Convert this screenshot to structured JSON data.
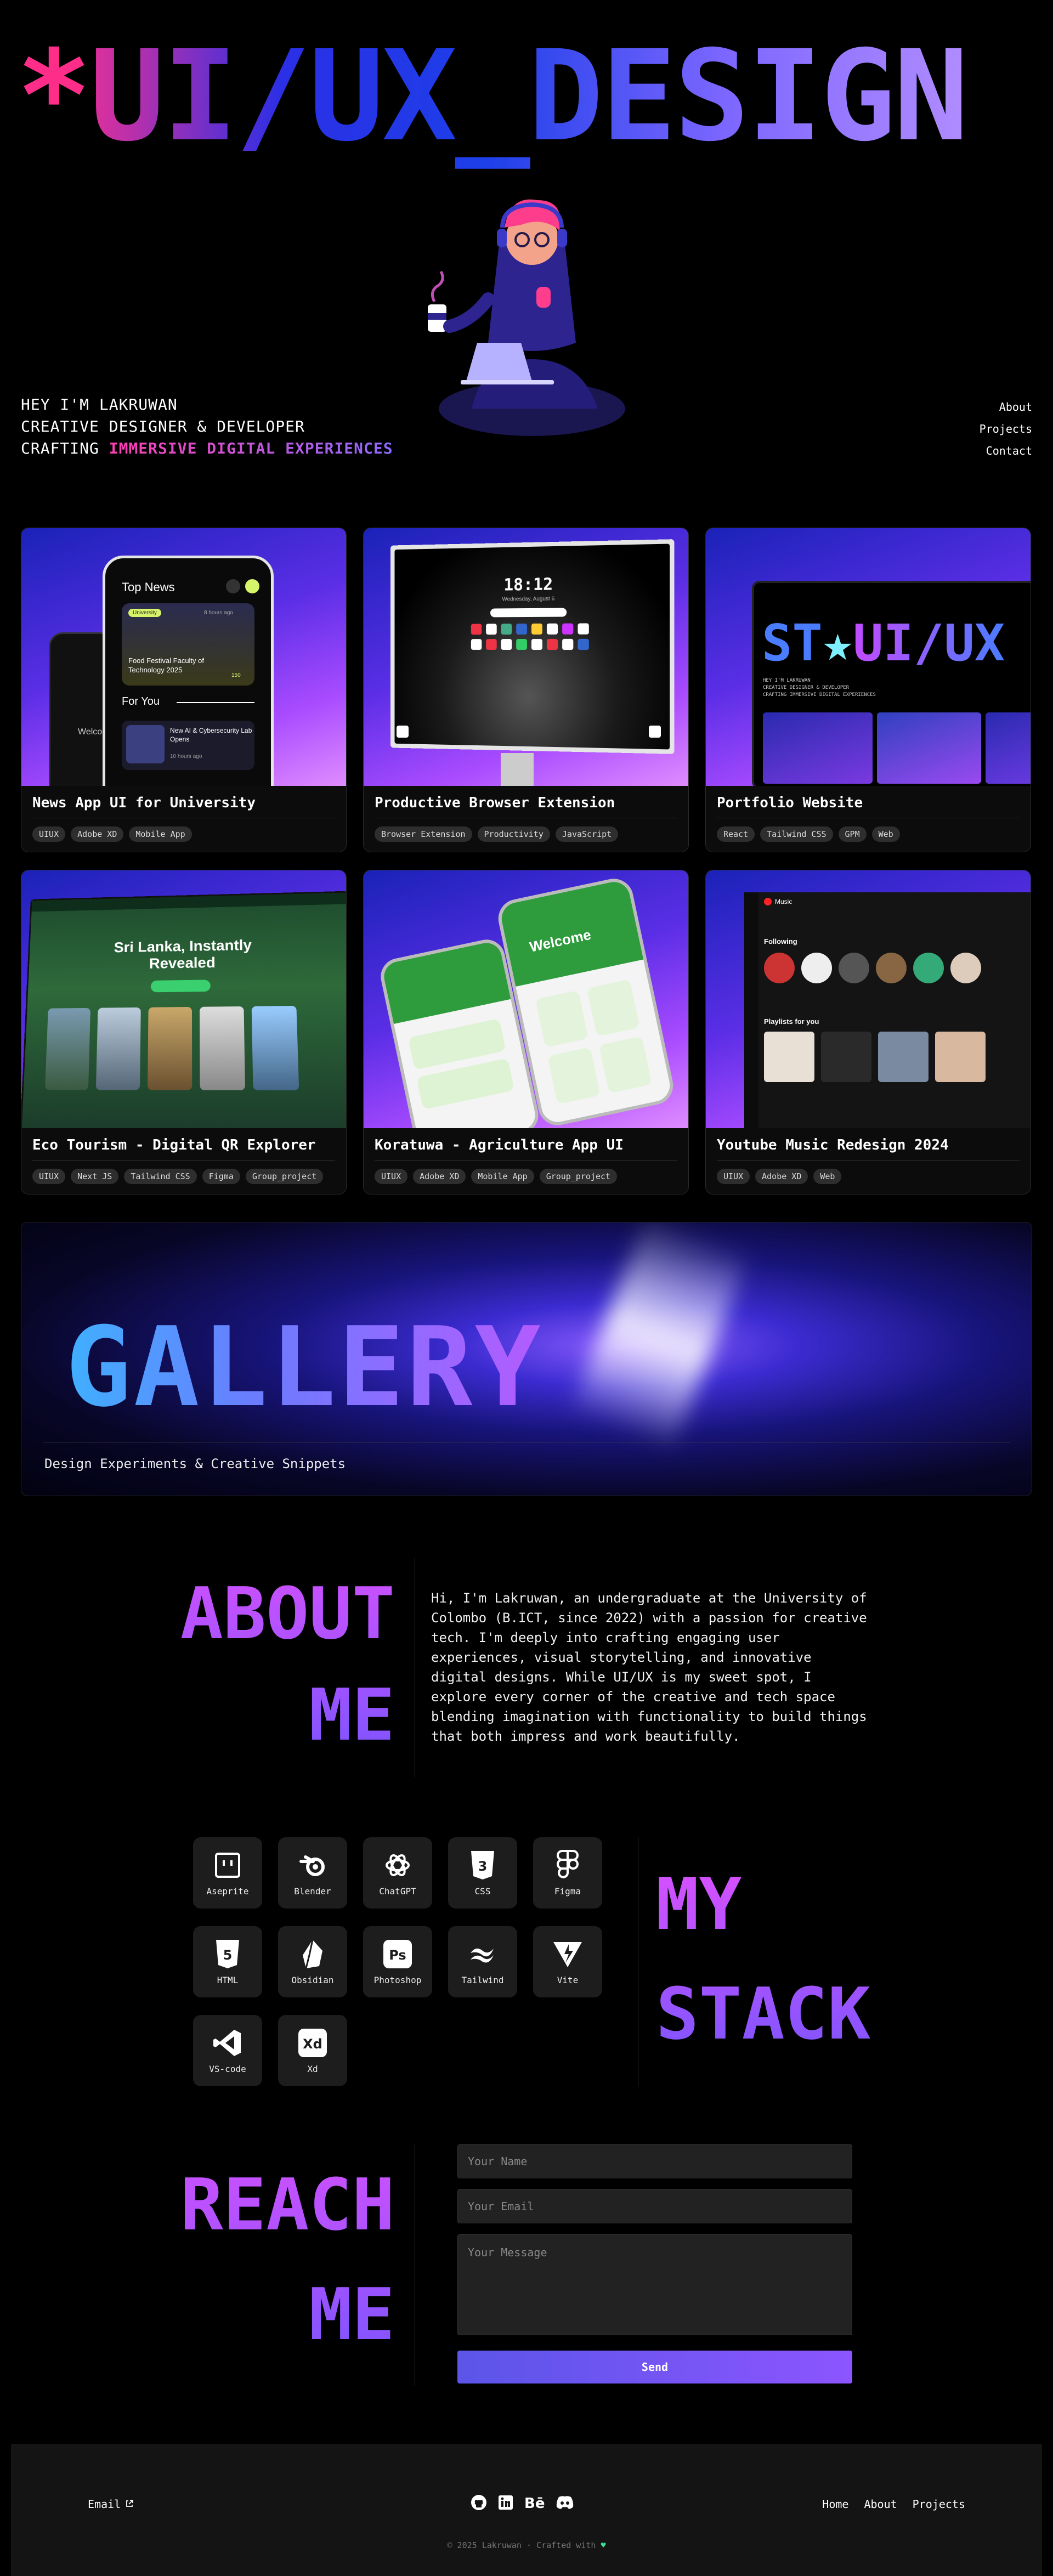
{
  "hero": {
    "asterisk": "*",
    "title": "UI/UX_DESIGN",
    "intro_line1": "HEY I'M LAKRUWAN",
    "intro_line2": "CREATIVE DESIGNER & DEVELOPER",
    "intro_line3_prefix": "CRAFTING ",
    "intro_line3_highlight": "IMMERSIVE DIGITAL EXPERIENCES",
    "nav": [
      "About",
      "Projects",
      "Contact"
    ]
  },
  "projects": [
    {
      "title": "News App UI for University",
      "tags": [
        "UIUX",
        "Adobe XD",
        "Mobile App"
      ],
      "thumb": {
        "heading": "Top News",
        "badge": "University",
        "time1": "8 hours ago",
        "headline1": "Food Festival Faculty of Technology 2025",
        "count": "150",
        "section": "For You",
        "headline2": "New AI & Cybersecurity Lab Opens",
        "time2": "10 hours ago",
        "back_text": "Welco"
      }
    },
    {
      "title": "Productive Browser Extension",
      "tags": [
        "Browser Extension",
        "Productivity",
        "JavaScript"
      ],
      "thumb": {
        "clock": "18:12",
        "date": "Wednesday, August 6"
      }
    },
    {
      "title": "Portfolio Website",
      "tags": [
        "React",
        "Tailwind CSS",
        "GPM",
        "Web"
      ],
      "thumb": {
        "title_left": "ST",
        "title_right": "UI/UX",
        "lines": [
          "HEY I'M LAKRUWAN",
          "CREATIVE DESIGNER & DEVELOPER",
          "CRAFTING IMMERSIVE DIGITAL EXPERIENCES"
        ]
      }
    },
    {
      "title": "Eco Tourism - Digital QR Explorer",
      "tags": [
        "UIUX",
        "Next JS",
        "Tailwind CSS",
        "Figma",
        "Group_project"
      ],
      "thumb": {
        "headline": "Sri Lanka, Instantly Revealed"
      }
    },
    {
      "title": "Koratuwa - Agriculture App UI",
      "tags": [
        "UIUX",
        "Adobe XD",
        "Mobile App",
        "Group_project"
      ],
      "thumb": {
        "welcome": "Welcome"
      }
    },
    {
      "title": "Youtube Music Redesign 2024",
      "tags": [
        "UIUX",
        "Adobe XD",
        "Web"
      ],
      "thumb": {
        "brand": "Music",
        "section1": "Following",
        "section2": "Playlists for you"
      }
    }
  ],
  "gallery": {
    "title": "GALLERY",
    "subtitle": "Design Experiments & Creative Snippets"
  },
  "about": {
    "heading_line1": "ABOUT",
    "heading_line2": "ME",
    "text": "Hi, I'm Lakruwan, an undergraduate at the University of Colombo (B.ICT, since 2022) with a passion for creative tech. I'm deeply into crafting engaging user experiences, visual storytelling, and innovative digital designs. While UI/UX is my sweet spot, I explore every corner of the creative and tech space blending imagination with functionality to build things that both impress and work beautifully."
  },
  "stack": {
    "heading_line1": "MY",
    "heading_line2": "STACK",
    "tools": [
      {
        "label": "Aseprite",
        "icon": "aseprite-icon"
      },
      {
        "label": "Blender",
        "icon": "blender-icon"
      },
      {
        "label": "ChatGPT",
        "icon": "chatgpt-icon"
      },
      {
        "label": "CSS",
        "icon": "css-icon"
      },
      {
        "label": "Figma",
        "icon": "figma-icon"
      },
      {
        "label": "HTML",
        "icon": "html-icon"
      },
      {
        "label": "Obsidian",
        "icon": "obsidian-icon"
      },
      {
        "label": "Photoshop",
        "icon": "photoshop-icon"
      },
      {
        "label": "Tailwind",
        "icon": "tailwind-icon"
      },
      {
        "label": "Vite",
        "icon": "vite-icon"
      },
      {
        "label": "VS-code",
        "icon": "vscode-icon"
      },
      {
        "label": "Xd",
        "icon": "xd-icon"
      }
    ]
  },
  "contact": {
    "heading_line1": "REACH",
    "heading_line2": "ME",
    "name_placeholder": "Your Name",
    "email_placeholder": "Your Email",
    "message_placeholder": "Your Message",
    "send_label": "Send"
  },
  "footer": {
    "email_label": "Email",
    "socials": [
      "github-icon",
      "linkedin-icon",
      "behance-icon",
      "discord-icon"
    ],
    "behance_text": "Bē",
    "links": [
      "Home",
      "About",
      "Projects"
    ],
    "copyright": "© 2025 Lakruwan · Crafted with",
    "heart": "♥"
  },
  "colors": {
    "accent_pink": "#ff2d8a",
    "accent_blue": "#2b2fe6",
    "accent_purple": "#8c55ff",
    "heart_green": "#3ddc97"
  }
}
